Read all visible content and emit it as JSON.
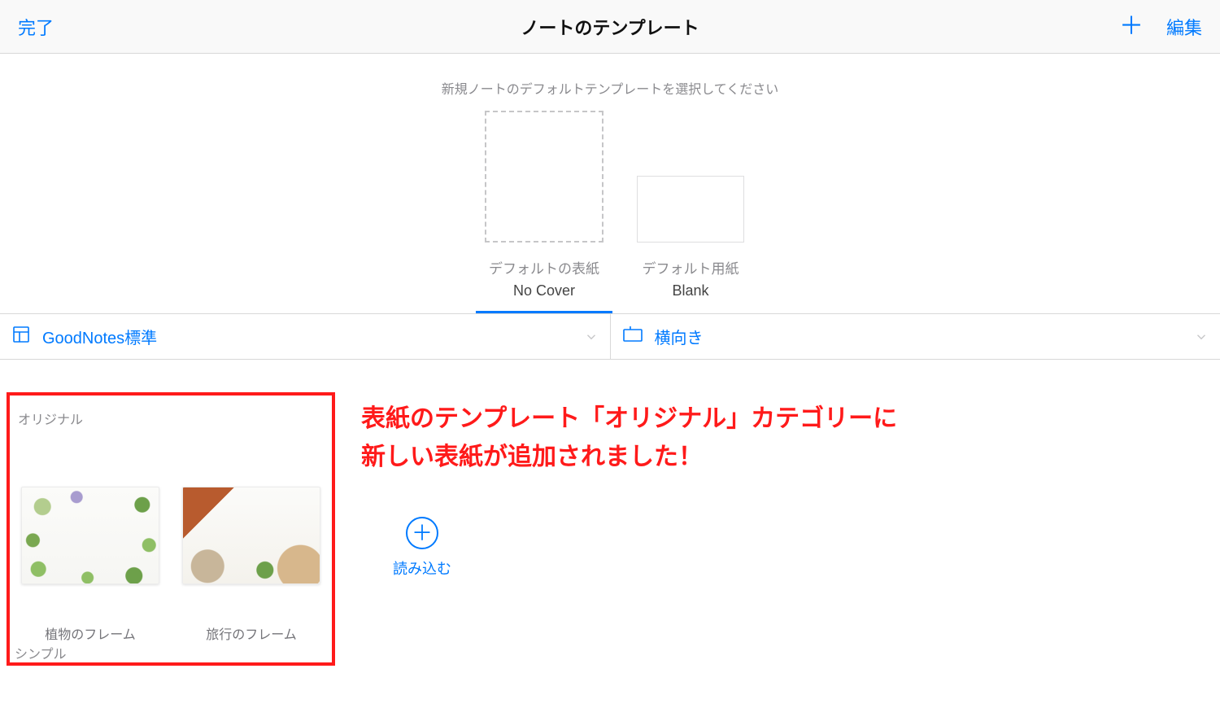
{
  "nav": {
    "done": "完了",
    "title": "ノートのテンプレート",
    "edit": "編集"
  },
  "defaults": {
    "hint": "新規ノートのデフォルトテンプレートを選択してください",
    "cover_caption": "デフォルトの表紙",
    "cover_value": "No Cover",
    "paper_caption": "デフォルト用紙",
    "paper_value": "Blank"
  },
  "filter": {
    "source": "GoodNotes標準",
    "orientation": "横向き"
  },
  "categories": {
    "original": "オリジナル",
    "simple": "シンプル"
  },
  "thumbs": {
    "plant": "植物のフレーム",
    "travel": "旅行のフレーム"
  },
  "import": "読み込む",
  "annotation_line1": "表紙のテンプレート「オリジナル」カテゴリーに",
  "annotation_line2": "新しい表紙が追加されました！"
}
